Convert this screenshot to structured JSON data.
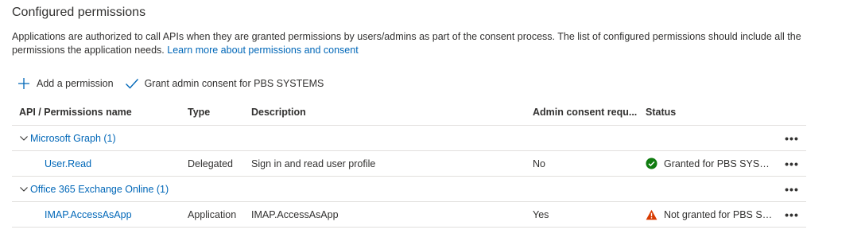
{
  "section": {
    "title": "Configured permissions",
    "description": "Applications are authorized to call APIs when they are granted permissions by users/admins as part of the consent process. The list of configured permissions should include all the permissions the application needs.",
    "learn_more": "Learn more about permissions and consent"
  },
  "toolbar": {
    "add_permission": "Add a permission",
    "grant_consent": "Grant admin consent for PBS SYSTEMS"
  },
  "table": {
    "headers": {
      "name": "API / Permissions name",
      "type": "Type",
      "description": "Description",
      "admin": "Admin consent requ...",
      "status": "Status"
    },
    "more_label": "•••",
    "groups": [
      {
        "label": "Microsoft Graph (1)",
        "permission": {
          "name": "User.Read",
          "type": "Delegated",
          "description": "Sign in and read user profile",
          "admin_consent": "No",
          "status": "Granted for PBS SYSTEMS",
          "status_icon": "check-circle-icon"
        }
      },
      {
        "label": "Office 365 Exchange Online (1)",
        "permission": {
          "name": "IMAP.AccessAsApp",
          "type": "Application",
          "description": "IMAP.AccessAsApp",
          "admin_consent": "Yes",
          "status": "Not granted for PBS SYSTEMS",
          "status_icon": "warning-icon"
        }
      }
    ]
  },
  "colors": {
    "link": "#0067b8",
    "success": "#107c10",
    "warning": "#d83b01",
    "divider": "#e1dfdd",
    "text": "#323130"
  }
}
